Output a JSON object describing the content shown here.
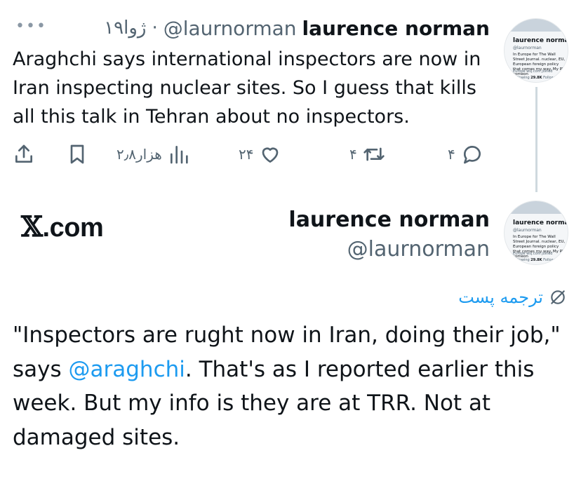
{
  "reply_tweet": {
    "author_name": "laurence norman",
    "author_handle": "@laurnorman",
    "separator": "·",
    "time": "۱۹ژوا",
    "text": "Araghchi says international inspectors are now in Iran inspecting nuclear sites. So I guess that kills all this talk in Tehran about no inspectors.",
    "actions": {
      "views": "۲٫۸هزار",
      "likes": "۲۴",
      "retweets": "۴",
      "replies": "۴"
    }
  },
  "avatar_card": {
    "name": "laurence norman",
    "handle": "@laurnorman",
    "bio": "In Europe for The Wall Street Journal. nuclear, EU, European foreign policy that comes my way. My RT, someon",
    "meta": "Europe  wsj.com  Joined",
    "stats_value": "29.8K",
    "stats_label": "Follow",
    "stats_prefix": "llowing"
  },
  "brand": {
    "logo_x": "𝕏",
    "logo_text": ".com"
  },
  "main_tweet": {
    "author_name": "laurence norman",
    "author_handle": "@laurnorman",
    "translate_label": "ترجمه پست",
    "text_before": "\"Inspectors are rught now in Iran, doing their job,\" says ",
    "mention": "@araghchi",
    "text_after": ". That's as I reported earlier this week. But my info is they are at TRR. Not at damaged sites."
  },
  "colors": {
    "text": "#0f1419",
    "secondary": "#536471",
    "link": "#1d9bf0",
    "thread_line": "#cfd9de"
  },
  "icons": [
    "more-icon",
    "share-icon",
    "bookmark-icon",
    "views-icon",
    "like-icon",
    "retweet-icon",
    "reply-icon",
    "verified-icon",
    "translate-icon"
  ]
}
